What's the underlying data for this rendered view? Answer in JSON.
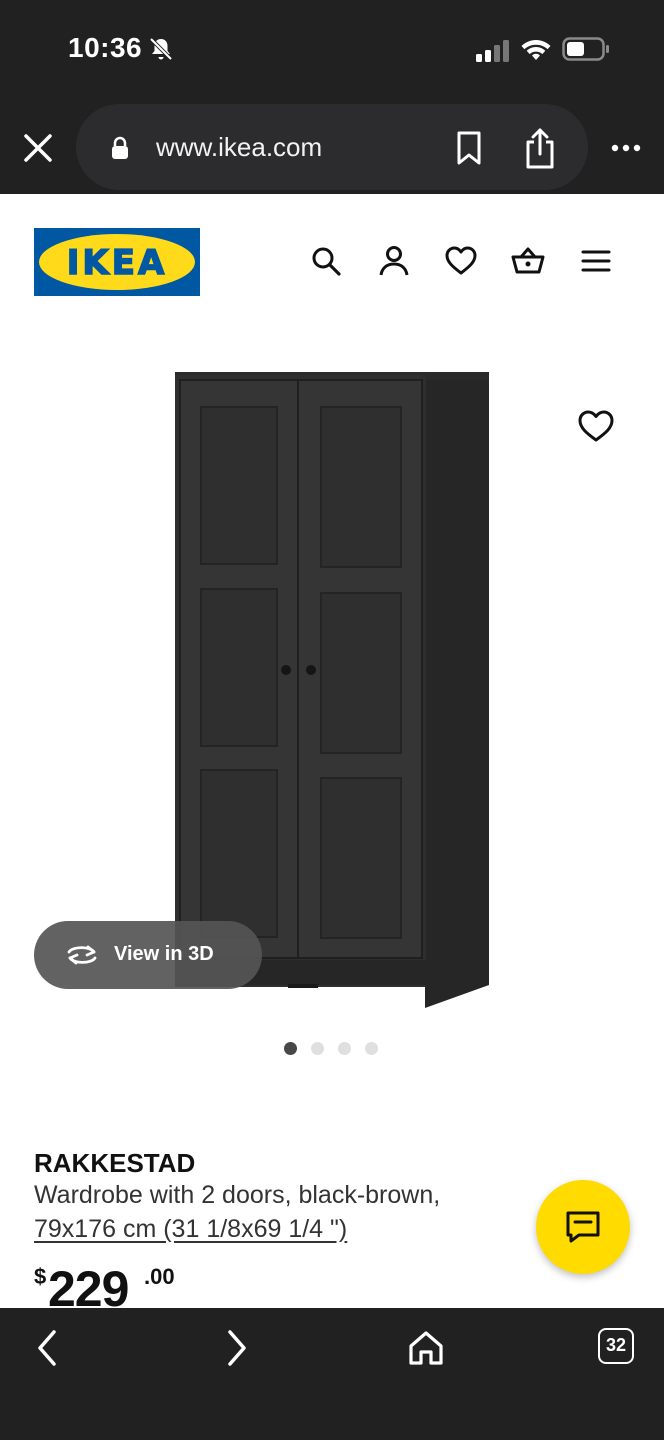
{
  "status_bar": {
    "time": "10:36"
  },
  "browser": {
    "url": "www.ikea.com"
  },
  "header": {
    "logo_text": "IKEA"
  },
  "product": {
    "view3d_label": "View in 3D",
    "name": "RAKKESTAD",
    "description": "Wardrobe with 2 doors, black-brown,",
    "size": "79x176 cm (31 1/8x69 1/4 \")",
    "price": {
      "currency": "$",
      "integer": "229",
      "decimal": ".00"
    },
    "carousel": {
      "total": 4,
      "active": 1
    }
  },
  "bottom_nav": {
    "tab_count": "32"
  },
  "colors": {
    "ikea_blue": "#0058a3",
    "ikea_yellow": "#ffda1a",
    "chrome_dark": "#212121",
    "chat_yellow": "#ffdb00"
  },
  "icons": [
    "bell-slash-icon",
    "signal-icon",
    "wifi-icon",
    "battery-icon",
    "close-icon",
    "lock-icon",
    "bookmark-icon",
    "share-icon",
    "more-icon",
    "search-icon",
    "user-icon",
    "heart-icon",
    "basket-icon",
    "menu-icon",
    "rotate-3d-icon",
    "chat-icon",
    "back-icon",
    "forward-icon",
    "home-icon",
    "tabs-icon"
  ]
}
